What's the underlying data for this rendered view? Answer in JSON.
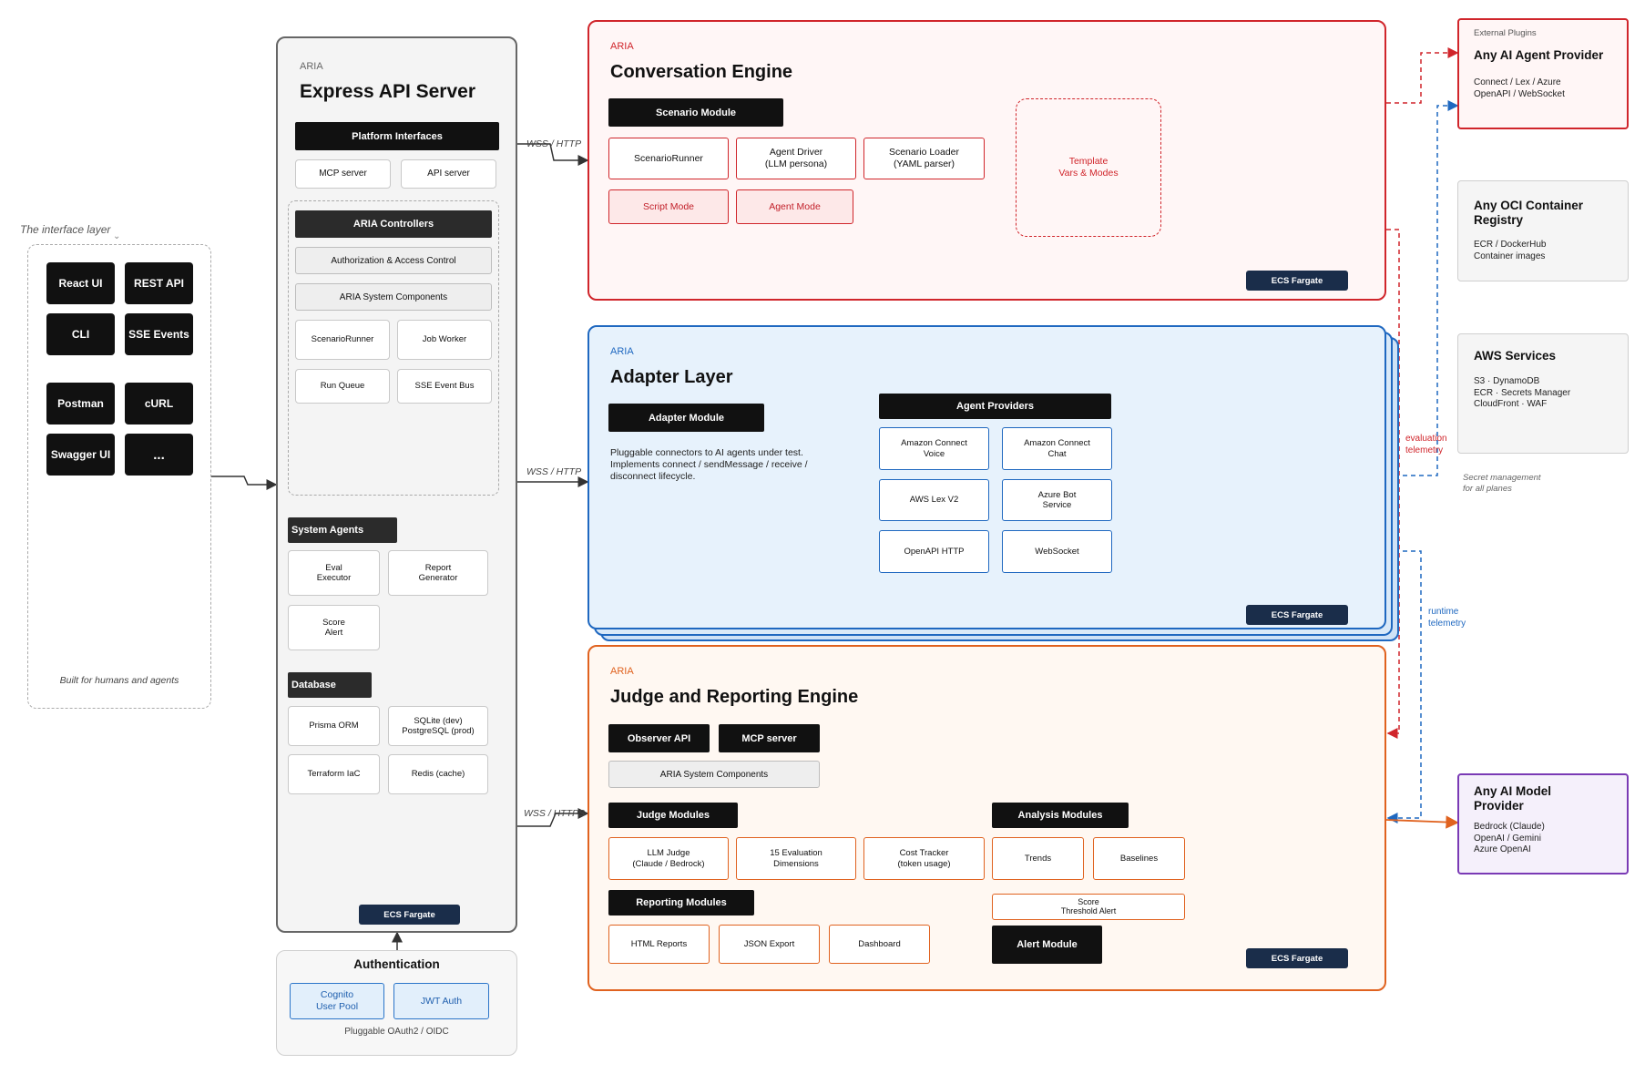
{
  "interface_layer": {
    "label": "The interface layer",
    "buttons": [
      "React UI",
      "REST API",
      "CLI",
      "SSE Events",
      "Postman",
      "cURL",
      "Swagger UI",
      "..."
    ],
    "footer": "Built for humans and agents"
  },
  "express": {
    "tag": "ARIA",
    "title": "Express API Server",
    "platform_interfaces": "Platform Interfaces",
    "mcp_server": "MCP server",
    "api_server": "API server",
    "controllers": "ARIA Controllers",
    "auth_access": "Authorization & Access Control",
    "system_components": "ARIA System Components",
    "scenario_runner": "ScenarioRunner",
    "job_worker": "Job Worker",
    "run_queue": "Run Queue",
    "sse_bus": "SSE Event Bus",
    "system_agents": "System Agents",
    "eval_executor": "Eval\nExecutor",
    "report_generator": "Report\nGenerator",
    "score_alert": "Score\nAlert",
    "database": "Database",
    "prisma": "Prisma ORM",
    "sqlite": "SQLite (dev)\nPostgreSQL (prod)",
    "terraform": "Terraform IaC",
    "redis": "Redis (cache)",
    "ecs": "ECS Fargate"
  },
  "auth": {
    "title": "Authentication",
    "cognito": "Cognito\nUser Pool",
    "jwt": "JWT Auth",
    "footer": "Pluggable OAuth2 / OIDC"
  },
  "connectors": {
    "c1": "WSS / HTTP",
    "c2": "WSS / HTTP",
    "c3": "WSS / HTTPS"
  },
  "conversation": {
    "tag": "ARIA",
    "title": "Conversation Engine",
    "module": "Scenario Module",
    "runner": "ScenarioRunner",
    "driver": "Agent Driver\n(LLM persona)",
    "loader": "Scenario Loader\n(YAML parser)",
    "script_mode": "Script Mode",
    "agent_mode": "Agent Mode",
    "template": "Template\nVars & Modes",
    "ecs": "ECS Fargate"
  },
  "adapter": {
    "tag": "ARIA",
    "title": "Adapter Layer",
    "module": "Adapter Module",
    "description": "Pluggable connectors to AI agents under test.\nImplements connect / sendMessage / receive /\ndisconnect lifecycle.",
    "providers_title": "Agent Providers",
    "providers": [
      "Amazon Connect\nVoice",
      "Amazon Connect\nChat",
      "AWS Lex V2",
      "Azure Bot\nService",
      "OpenAPI HTTP",
      "WebSocket"
    ],
    "ecs": "ECS Fargate"
  },
  "judge": {
    "tag": "ARIA",
    "title": "Judge and Reporting Engine",
    "observer_api": "Observer API",
    "mcp_server": "MCP server",
    "system_components": "ARIA System Components",
    "judge_modules": "Judge Modules",
    "llm_judge": "LLM Judge\n(Claude / Bedrock)",
    "eval_dims": "15 Evaluation\nDimensions",
    "cost_tracker": "Cost Tracker\n(token usage)",
    "analysis_modules": "Analysis Modules",
    "trends": "Trends",
    "baselines": "Baselines",
    "score_threshold": "Score\nThreshold Alert",
    "alert_module": "Alert Module",
    "reporting_modules": "Reporting Modules",
    "html_reports": "HTML Reports",
    "json_export": "JSON Export",
    "dashboard": "Dashboard",
    "ecs": "ECS Fargate"
  },
  "right": {
    "plugins": {
      "tag": "External Plugins",
      "title": "Any AI Agent Provider",
      "sub": "Connect / Lex / Azure\nOpenAPI / WebSocket"
    },
    "oci": {
      "title": "Any OCI Container\nRegistry",
      "sub": "ECR / DockerHub\nContainer images"
    },
    "aws": {
      "title": "AWS Services",
      "sub": "S3 · DynamoDB\nECR · Secrets Manager\nCloudFront · WAF"
    },
    "secret_note": "Secret management\nfor all planes",
    "model": {
      "title": "Any AI Model\nProvider",
      "sub": "Bedrock (Claude)\nOpenAI / Gemini\nAzure OpenAI"
    }
  },
  "telemetry": {
    "evaluation": "evaluation\ntelemetry",
    "runtime": "runtime\ntelemetry"
  }
}
